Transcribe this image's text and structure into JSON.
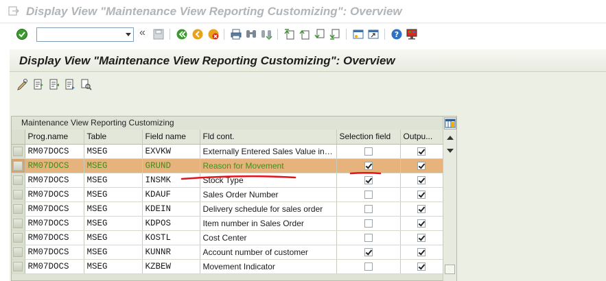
{
  "window": {
    "title": "Display View \"Maintenance View Reporting Customizing\": Overview"
  },
  "toolbar": {
    "command_value": "",
    "back_chevrons": "«"
  },
  "screen": {
    "title": "Display View \"Maintenance View Reporting Customizing\": Overview"
  },
  "table": {
    "title": "Maintenance View Reporting Customizing",
    "headers": {
      "prog": "Prog.name",
      "table": "Table",
      "field": "Field name",
      "cont": "Fld cont.",
      "sel": "Selection field",
      "out": "Outpu..."
    },
    "rows": [
      {
        "prog": "RM07DOCS",
        "table": "MSEG",
        "field": "EXVKW",
        "cont": "Externally Entered Sales Value in L...",
        "sel": false,
        "out": true
      },
      {
        "prog": "RM07DOCS",
        "table": "MSEG",
        "field": "GRUND",
        "cont": "Reason for Movement",
        "sel": true,
        "out": true
      },
      {
        "prog": "RM07DOCS",
        "table": "MSEG",
        "field": "INSMK",
        "cont": "Stock Type",
        "sel": true,
        "out": true
      },
      {
        "prog": "RM07DOCS",
        "table": "MSEG",
        "field": "KDAUF",
        "cont": "Sales Order Number",
        "sel": false,
        "out": true
      },
      {
        "prog": "RM07DOCS",
        "table": "MSEG",
        "field": "KDEIN",
        "cont": "Delivery schedule for sales order",
        "sel": false,
        "out": true
      },
      {
        "prog": "RM07DOCS",
        "table": "MSEG",
        "field": "KDPOS",
        "cont": "Item number in Sales Order",
        "sel": false,
        "out": true
      },
      {
        "prog": "RM07DOCS",
        "table": "MSEG",
        "field": "KOSTL",
        "cont": "Cost Center",
        "sel": false,
        "out": true
      },
      {
        "prog": "RM07DOCS",
        "table": "MSEG",
        "field": "KUNNR",
        "cont": "Account number of customer",
        "sel": true,
        "out": true
      },
      {
        "prog": "RM07DOCS",
        "table": "MSEG",
        "field": "KZBEW",
        "cont": "Movement Indicator",
        "sel": false,
        "out": true
      }
    ]
  },
  "colors": {
    "highlight_row": "#e6b37c",
    "highlight_text": "#3f8e1b",
    "annotation_red": "#e0141b"
  }
}
